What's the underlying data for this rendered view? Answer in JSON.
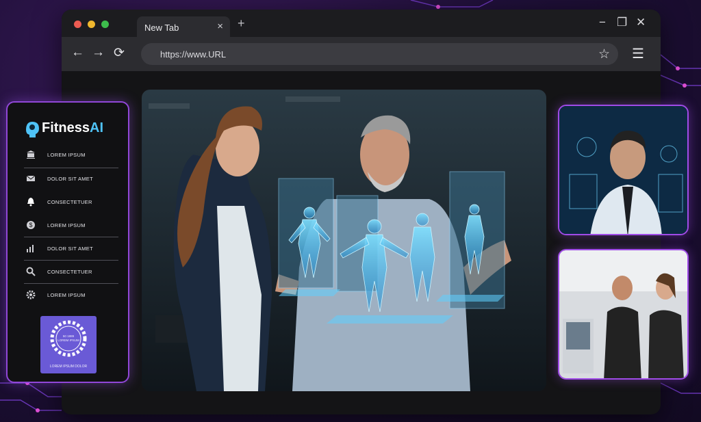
{
  "browser": {
    "tab_title": "New Tab",
    "tab_close": "×",
    "new_tab": "+",
    "url": "https://www.URL",
    "back": "←",
    "forward": "→",
    "reload": "⟳",
    "bookmark": "☆",
    "menu": "☰",
    "window_min": "−",
    "window_max": "❐",
    "window_close": "✕"
  },
  "sidebar": {
    "brand_prefix": "Fitness",
    "brand_suffix": "AI",
    "items": [
      {
        "label": "LOREM IPSUM",
        "icon": "bank-icon"
      },
      {
        "label": "DOLOR SIT AMET",
        "icon": "mail-icon"
      },
      {
        "label": "CONSECTETUER",
        "icon": "bell-icon"
      },
      {
        "label": "LOREM IPSUM",
        "icon": "dollar-icon"
      },
      {
        "label": "DOLOR SIT AMET",
        "icon": "bar-chart-icon"
      },
      {
        "label": "CONSECTETUER",
        "icon": "search-icon"
      },
      {
        "label": "LOREM IPSUM",
        "icon": "gear-icon"
      }
    ],
    "badge_text": "LOREM IPSUM DOLOR",
    "badge_inner_1": "50 1889",
    "badge_inner_2": "LOREM IPSUM"
  },
  "colors": {
    "accent": "#9147d8",
    "brand_ai": "#4fc3f7",
    "hologram": "#5fd0ff"
  }
}
